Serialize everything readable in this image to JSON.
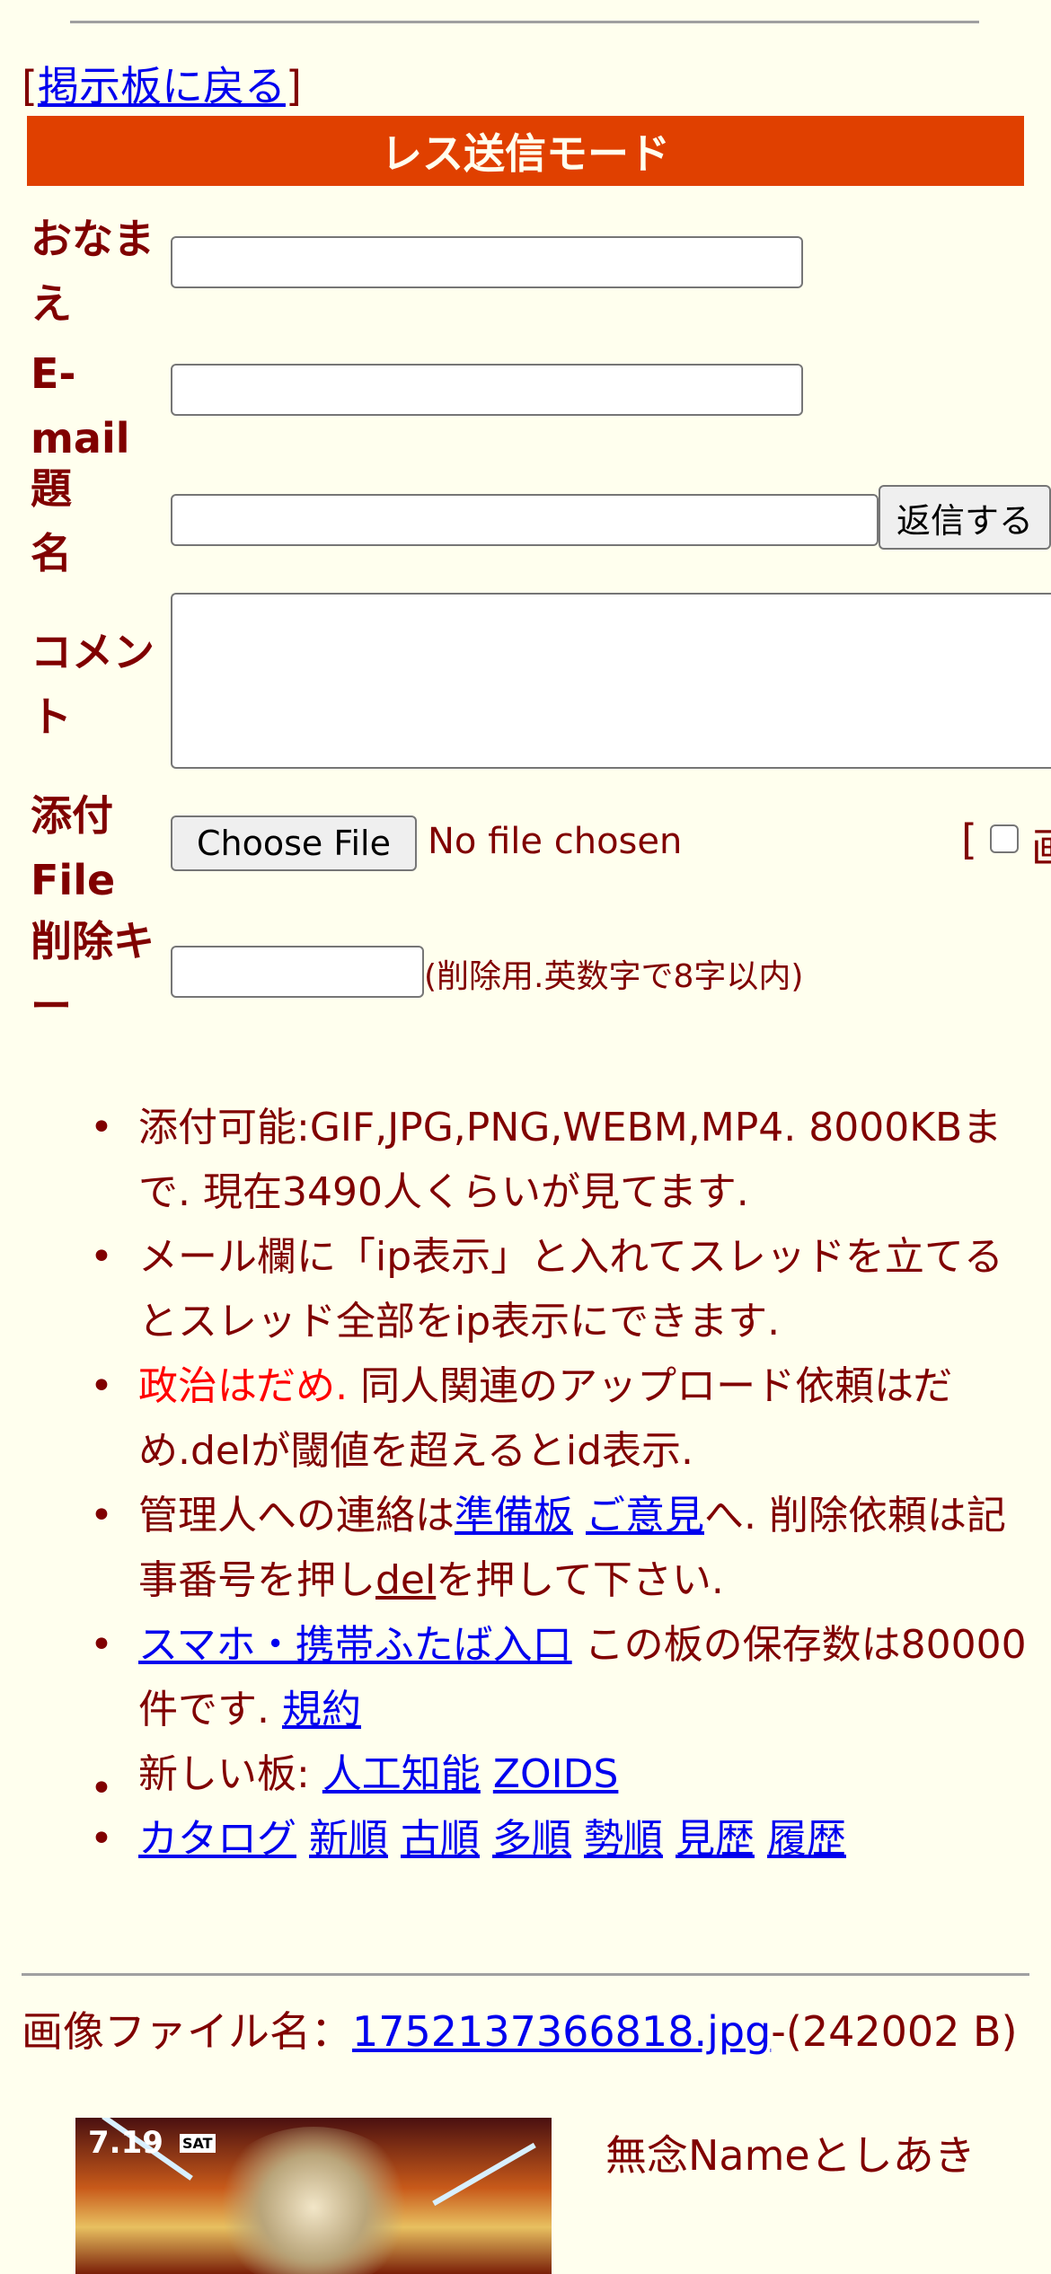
{
  "nav": {
    "back_open": "[",
    "back_label": "掲示板に戻る",
    "back_close": "]"
  },
  "form": {
    "title": "レス送信モード",
    "name_label": "おなまえ",
    "email_label": "E-mail",
    "subject_label": "題名",
    "submit_label": "返信する",
    "comment_label": "コメント",
    "attach_label_1": "添付",
    "attach_label_2": "File",
    "choose_file_label": "Choose File",
    "no_file_text": "No file chosen",
    "extra_open": "[",
    "extra_label_partial": "画",
    "delkey_label_1": "削除キ",
    "delkey_label_2": "ー",
    "delkey_hint": "(削除用.英数字で8字以内)"
  },
  "notes": {
    "n1": "添付可能:GIF,JPG,PNG,WEBM,MP4. 8000KBまで. 現在3490人くらいが見てます.",
    "n2": "メール欄に「ip表示」と入れてスレッドを立てるとスレッド全部をip表示にできます.",
    "n3_red": "政治はだめ.",
    "n3_rest": " 同人関連のアップロード依頼はだめ.delが閾値を超えるとid表示.",
    "n4_a": "管理人への連絡は",
    "n4_link1": "準備板",
    "n4_link2": "ご意見",
    "n4_b": "へ. 削除依頼は記事番号を押し",
    "n4_link3": "del",
    "n4_c": "を押して下さい.",
    "n5_link": "スマホ・携帯ふたば入口",
    "n5_text": " この板の保存数は80000件です. ",
    "n5_link2": "規約",
    "n6_text": "新しい板: ",
    "n6_link1": "人工知能",
    "n6_link2": "ZOIDS",
    "sort_links": [
      "カタログ",
      "新順",
      "古順",
      "多順",
      "勢順",
      "見歴",
      "履歴"
    ]
  },
  "post": {
    "file_prefix": "画像ファイル名：",
    "file_link": "1752137366818.jpg",
    "file_suffix": "-(242002 B)",
    "thumb_date": "7.19",
    "thumb_day": "SAT",
    "poster_line": "無念Nameとしあき"
  },
  "colors": {
    "background": "#ffffee",
    "text": "#800000",
    "banner": "#e04000",
    "link": "#0000ee",
    "warning": "#ff0000"
  }
}
